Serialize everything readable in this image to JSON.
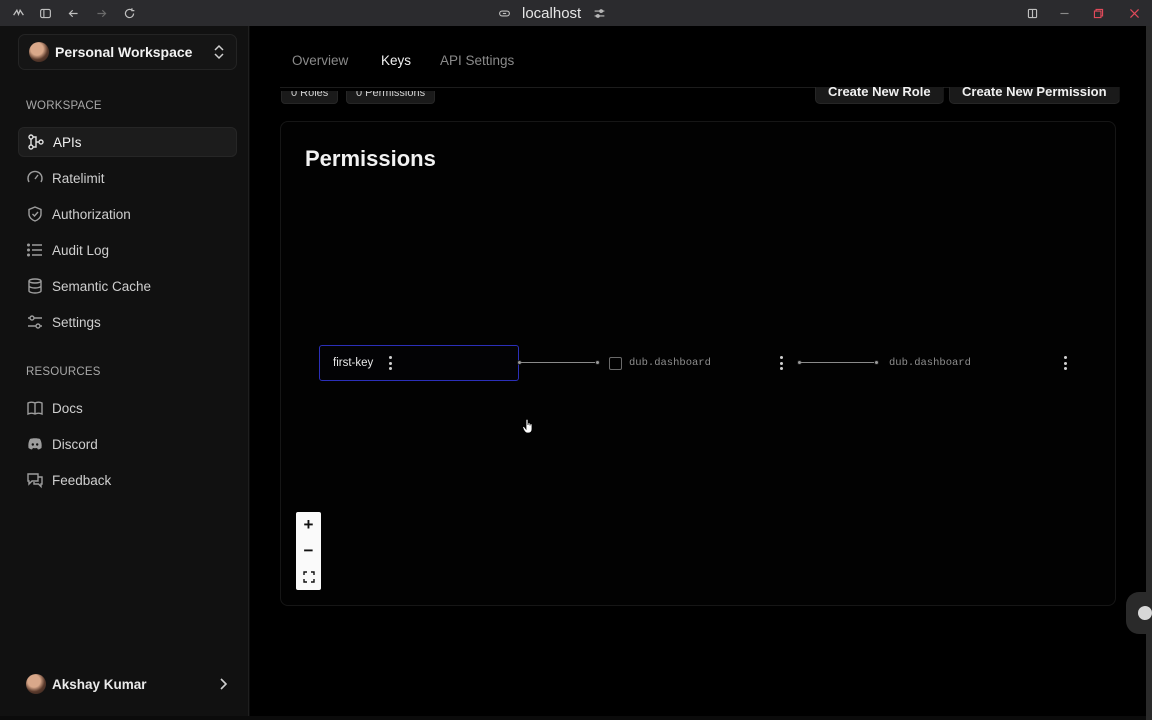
{
  "browser": {
    "url": "localhost",
    "icons": [
      "app-logo-icon",
      "sidebar-toggle-icon",
      "back-icon",
      "forward-icon",
      "reload-icon",
      "link-icon",
      "tune-icon",
      "split-view-icon",
      "minimize-icon",
      "restore-icon",
      "close-icon"
    ]
  },
  "sidebar": {
    "workspace": "Personal Workspace",
    "workspace_section": "WORKSPACE",
    "workspace_items": [
      {
        "label": "APIs",
        "icon": "nodes-icon",
        "active": true
      },
      {
        "label": "Ratelimit",
        "icon": "gauge-icon"
      },
      {
        "label": "Authorization",
        "icon": "shield-icon"
      },
      {
        "label": "Audit Log",
        "icon": "list-icon"
      },
      {
        "label": "Semantic Cache",
        "icon": "database-icon"
      },
      {
        "label": "Settings",
        "icon": "sliders-icon"
      }
    ],
    "resources_section": "RESOURCES",
    "resource_items": [
      {
        "label": "Docs",
        "icon": "book-icon"
      },
      {
        "label": "Discord",
        "icon": "discord-icon"
      },
      {
        "label": "Feedback",
        "icon": "message-icon"
      }
    ],
    "user": "Akshay Kumar"
  },
  "tabs": [
    {
      "label": "Overview"
    },
    {
      "label": "Keys",
      "active": true
    },
    {
      "label": "API Settings"
    }
  ],
  "toolbar": {
    "roles_chip": "0 Roles",
    "permissions_chip": "0 Permissions",
    "create_role": "Create New Role",
    "create_permission": "Create New Permission"
  },
  "permissions": {
    "title": "Permissions",
    "key_node": "first-key",
    "role_node": "dub.dashboard",
    "permission_node": "dub.dashboard"
  },
  "zoom_controls": {
    "zoom_in": "+",
    "zoom_out": "−",
    "fit": "fit-view-icon"
  },
  "colors": {
    "accent_selected_border": "#2b2fb8",
    "background": "#000000",
    "sidebar": "#111111"
  }
}
